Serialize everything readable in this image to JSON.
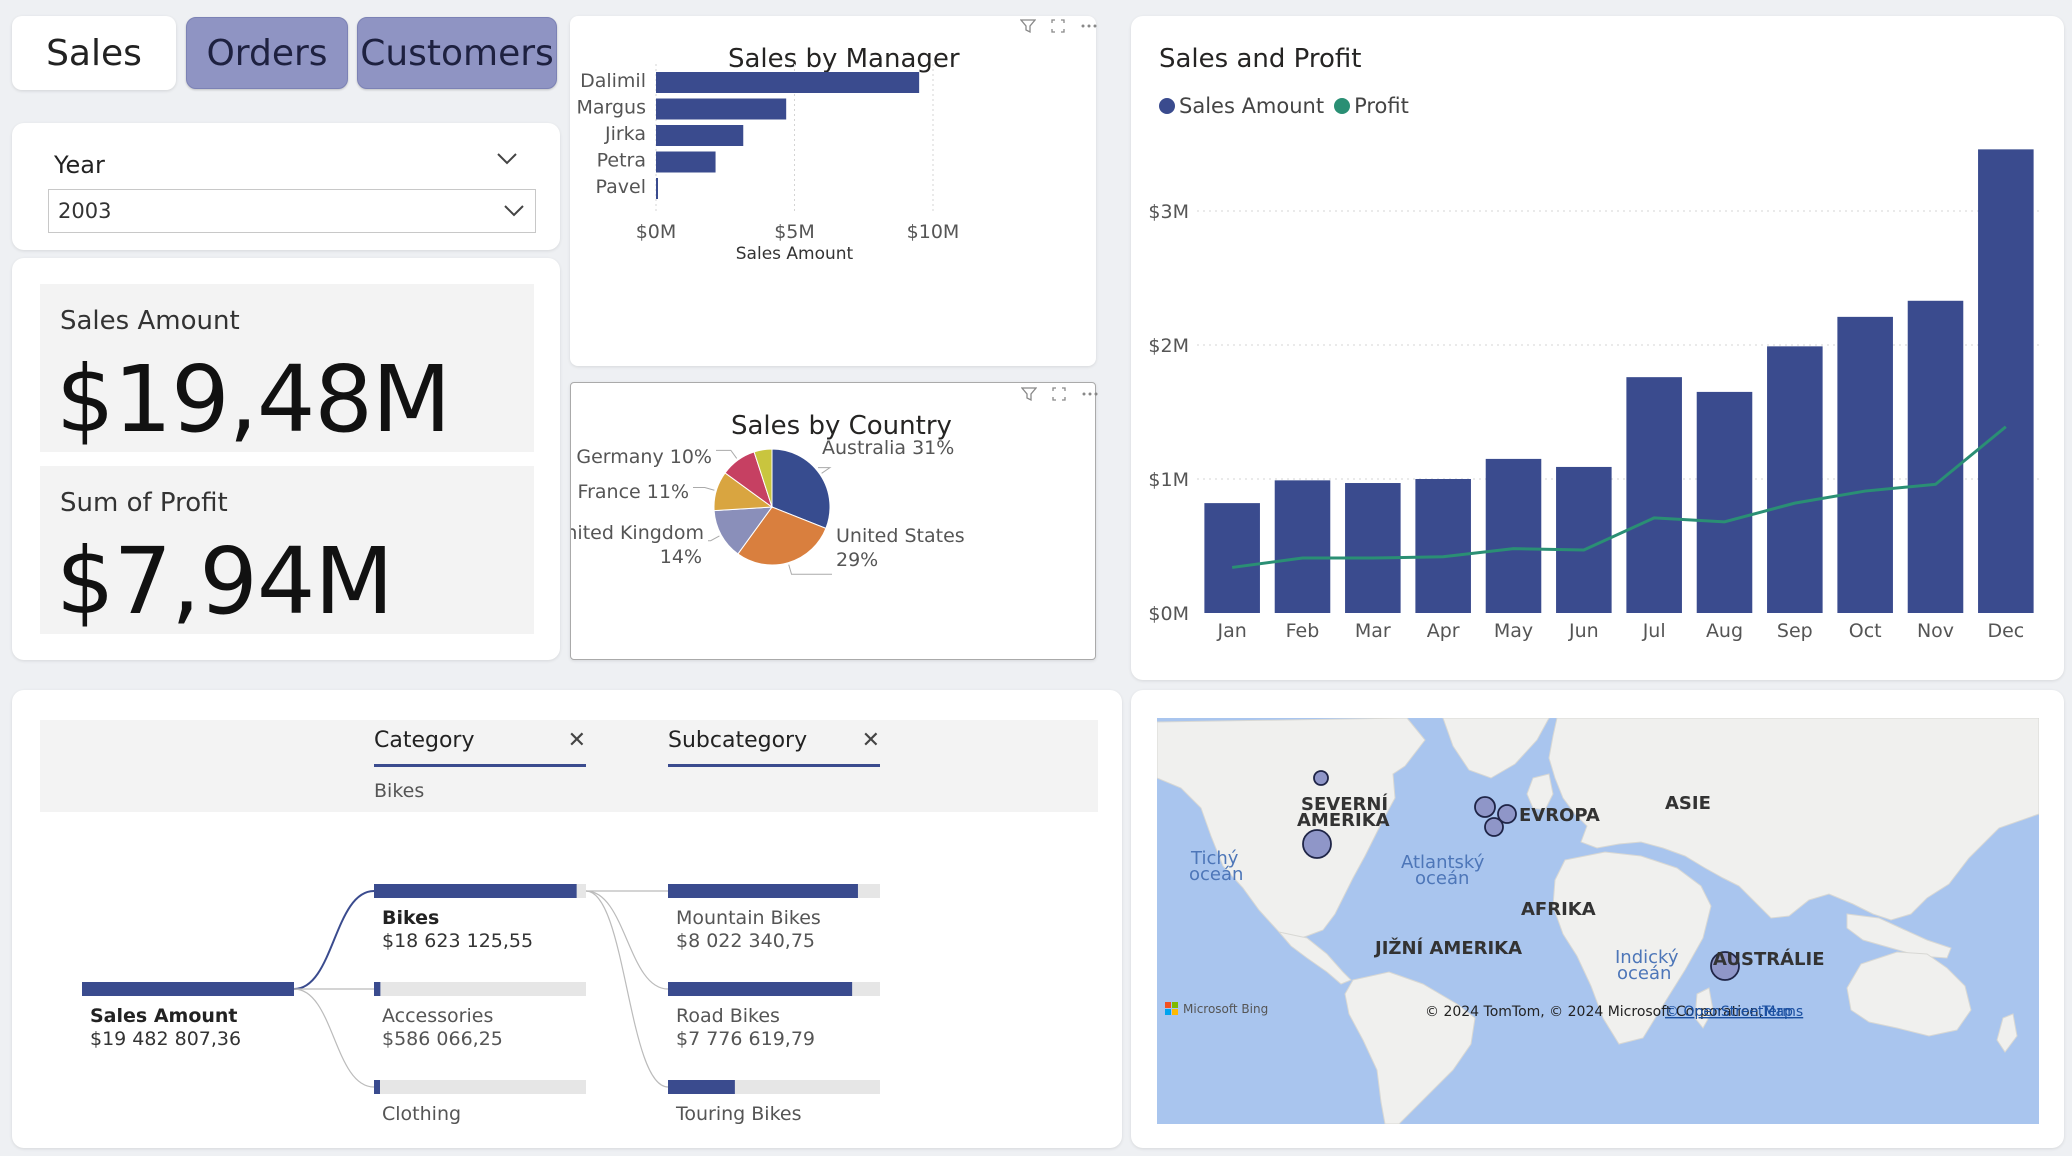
{
  "tabs": [
    {
      "label": "Sales",
      "active": true
    },
    {
      "label": "Orders",
      "active": false
    },
    {
      "label": "Customers",
      "active": false
    }
  ],
  "slicer": {
    "label": "Year",
    "value": "2003"
  },
  "kpis": {
    "sales_label": "Sales Amount",
    "sales_value": "$19,48M",
    "profit_label": "Sum of Profit",
    "profit_value": "$7,94M"
  },
  "manager_chart_title": "Sales by Manager",
  "country_chart_title": "Sales by Country",
  "monthly_chart_title": "Sales and Profit",
  "chart_data": [
    {
      "type": "bar",
      "orientation": "horizontal",
      "title": "Sales by Manager",
      "categories": [
        "Dalimil",
        "Margus",
        "Jirka",
        "Petra",
        "Pavel"
      ],
      "values": [
        9.5,
        4.7,
        3.15,
        2.15,
        0.06
      ],
      "value_unit": "$M",
      "xlabel": "Sales Amount",
      "xlim": [
        0,
        10
      ],
      "xticks": [
        "$0M",
        "$5M",
        "$10M"
      ],
      "color": "#3a4b8e"
    },
    {
      "type": "pie",
      "title": "Sales by Country",
      "slices": [
        {
          "label": "Australia",
          "pct_label": "31%",
          "value": 31,
          "color": "#374c8f"
        },
        {
          "label": "United States",
          "pct_label": "29%",
          "value": 29,
          "color": "#d97f3e"
        },
        {
          "label": "United Kingdom",
          "pct_label": "14%",
          "value": 14,
          "color": "#8a8fba"
        },
        {
          "label": "France",
          "pct_label": "11%",
          "value": 11,
          "color": "#d9a540"
        },
        {
          "label": "Germany",
          "pct_label": "10%",
          "value": 10,
          "color": "#c64062"
        },
        {
          "label": "",
          "pct_label": "",
          "value": 5,
          "color": "#c9c53e"
        }
      ]
    },
    {
      "type": "bar",
      "title": "Sales and Profit",
      "categories": [
        "Jan",
        "Feb",
        "Mar",
        "Apr",
        "May",
        "Jun",
        "Jul",
        "Aug",
        "Sep",
        "Oct",
        "Nov",
        "Dec"
      ],
      "series": [
        {
          "name": "Sales Amount",
          "type": "bar",
          "color": "#3a4b8e",
          "values": [
            0.82,
            0.99,
            0.97,
            1.0,
            1.15,
            1.09,
            1.76,
            1.65,
            1.99,
            2.21,
            2.33,
            3.46
          ]
        },
        {
          "name": "Profit",
          "type": "line",
          "color": "#2a8f74",
          "values": [
            0.34,
            0.41,
            0.41,
            0.42,
            0.48,
            0.47,
            0.71,
            0.68,
            0.82,
            0.91,
            0.96,
            1.39
          ]
        }
      ],
      "ylim": [
        0,
        3.5
      ],
      "yticks": [
        {
          "v": 0,
          "label": "$0M"
        },
        {
          "v": 1,
          "label": "$1M"
        },
        {
          "v": 2,
          "label": "$2M"
        },
        {
          "v": 3,
          "label": "$3M"
        }
      ],
      "grid": true,
      "legend": "top-left"
    }
  ],
  "decomp": {
    "filters": [
      {
        "label": "Category",
        "value": "Bikes"
      },
      {
        "label": "Subcategory",
        "value": ""
      }
    ],
    "root": {
      "label": "Sales Amount",
      "value": "$19 482 807,36",
      "amount": 19482807.36
    },
    "level1": [
      {
        "label": "Bikes",
        "value": "$18 623 125,55",
        "amount": 18623125.55,
        "selected": true
      },
      {
        "label": "Accessories",
        "value": "$586 066,25",
        "amount": 586066.25,
        "selected": false
      },
      {
        "label": "Clothing",
        "value": "",
        "amount": 273615.56,
        "selected": false
      }
    ],
    "level2": [
      {
        "label": "Mountain Bikes",
        "value": "$8 022 340,75",
        "amount": 8022340.75
      },
      {
        "label": "Road Bikes",
        "value": "$7 776 619,79",
        "amount": 7776619.79
      },
      {
        "label": "Touring Bikes",
        "value": "",
        "amount": 2824165.01
      }
    ]
  },
  "map": {
    "continents": [
      "SEVERNÍ",
      "AMERIKA",
      "EVROPA",
      "ASIE",
      "AFRIKA",
      "JIŽNÍ AMERIKA",
      "AUSTRÁLIE"
    ],
    "oceans": [
      "Tichý",
      "oceán",
      "Atlantský",
      "oceán",
      "Indický",
      "oceán"
    ],
    "brand": "Microsoft Bing",
    "attribution": "© 2024 TomTom, © 2024 Microsoft Corporation,",
    "attribution_link": "© OpenStreetMap",
    "terms": "Terms"
  }
}
